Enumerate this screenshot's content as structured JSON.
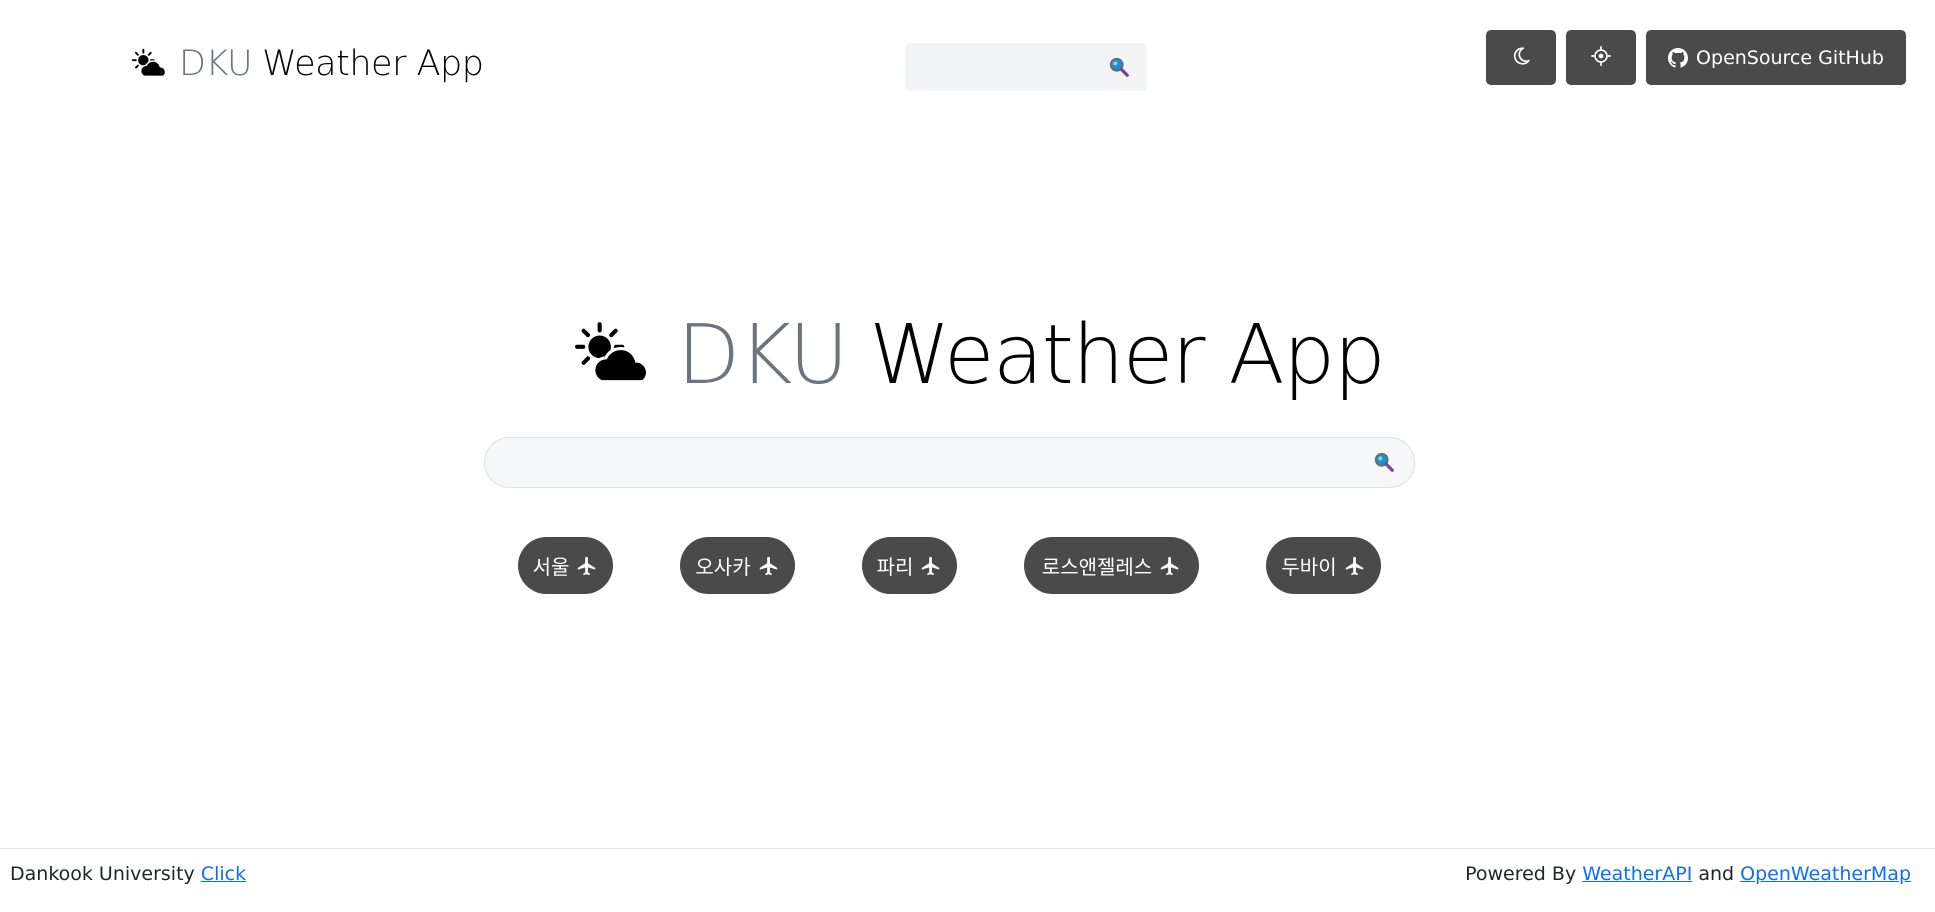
{
  "header": {
    "brand": {
      "icon": "sun-behind-cloud-icon",
      "muted": "DKU",
      "main": "Weather App"
    },
    "search": {
      "value": "",
      "placeholder": "",
      "icon": "magnifier-icon"
    },
    "buttons": {
      "theme": {
        "icon": "moon-icon"
      },
      "locate": {
        "icon": "crosshair-icon"
      },
      "github": {
        "icon": "github-icon",
        "label": "OpenSource GitHub"
      }
    }
  },
  "hero": {
    "icon": "sun-behind-cloud-icon",
    "title_muted": "DKU",
    "title_main": "Weather App",
    "search": {
      "value": "",
      "placeholder": "",
      "icon": "magnifier-icon"
    }
  },
  "cities": [
    {
      "label": "서울",
      "icon": "airplane-icon"
    },
    {
      "label": "오사카",
      "icon": "airplane-icon"
    },
    {
      "label": "파리",
      "icon": "airplane-icon"
    },
    {
      "label": "로스앤젤레스",
      "icon": "airplane-icon"
    },
    {
      "label": "두바이",
      "icon": "airplane-icon"
    }
  ],
  "footer": {
    "left_text": "Dankook University",
    "left_link": "Click",
    "right_prefix": "Powered By",
    "right_link1": "WeatherAPI",
    "right_and": "and",
    "right_link2": "OpenWeatherMap"
  },
  "colors": {
    "button_dark": "#4a4a4a",
    "brand_muted": "#6c757d",
    "link": "#0d6efd",
    "search_bg": "#f6f7f9"
  }
}
